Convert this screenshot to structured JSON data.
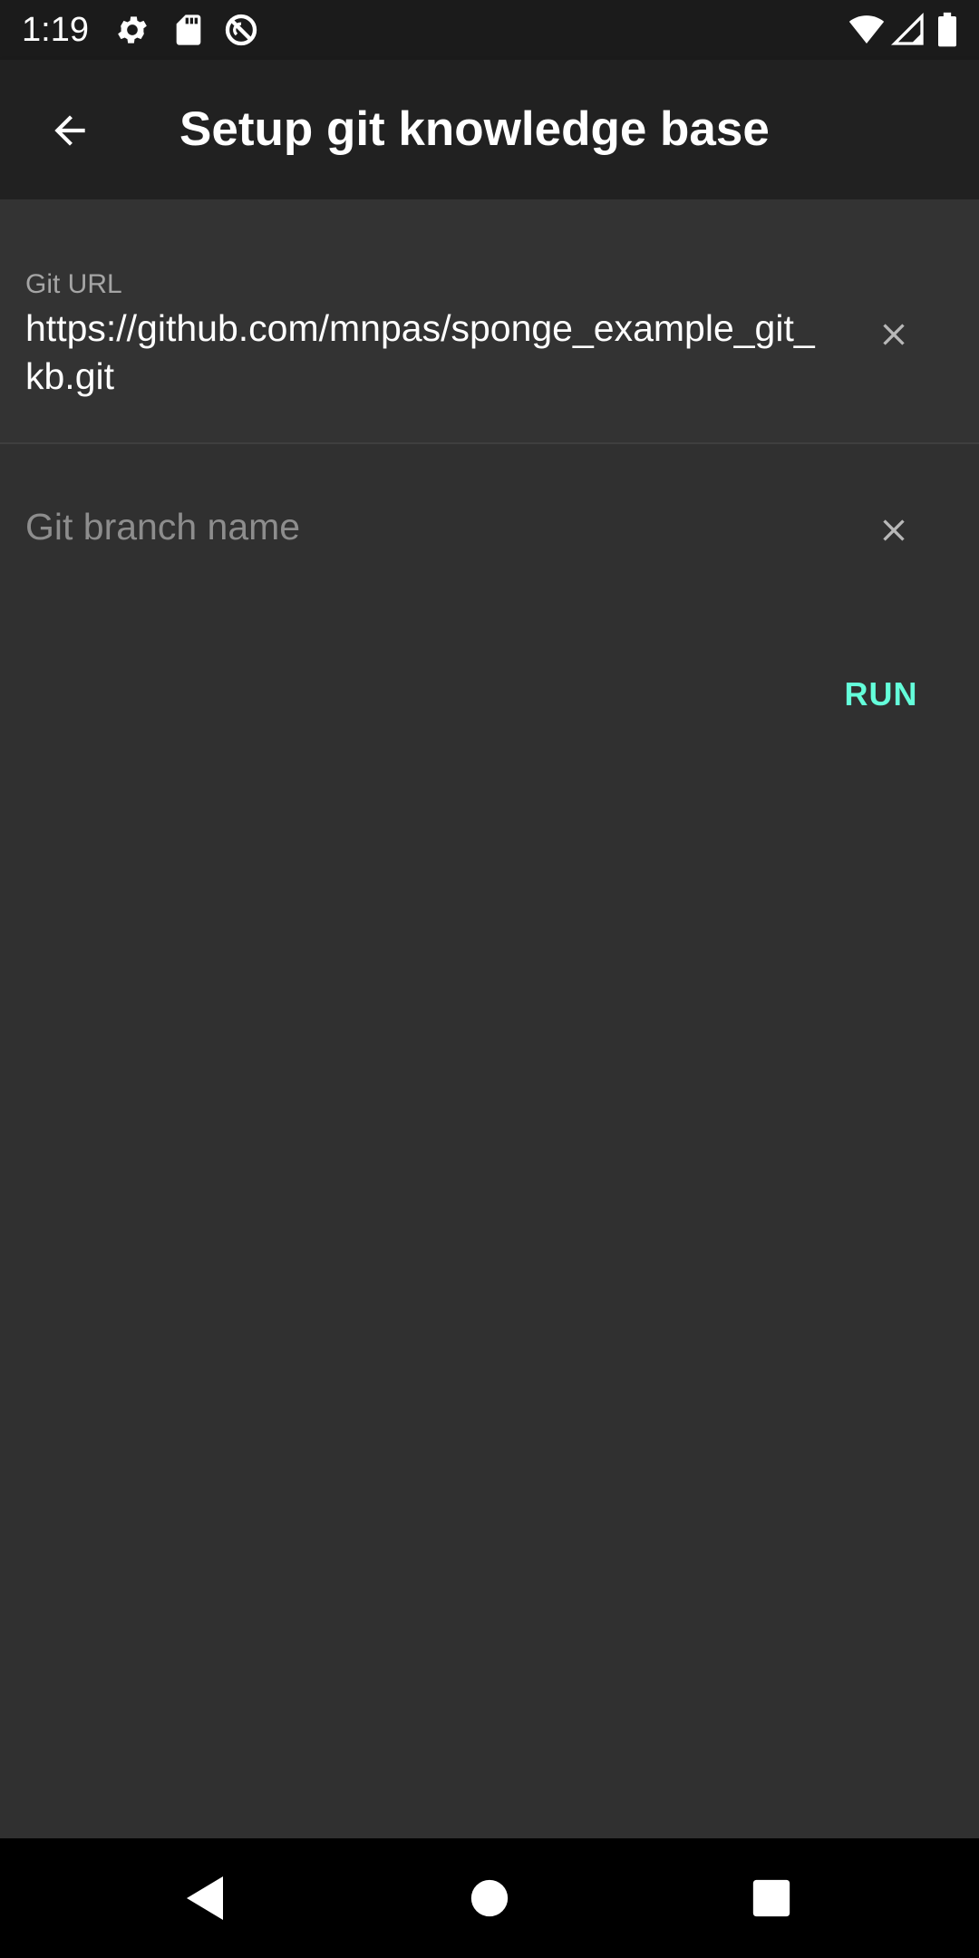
{
  "status_bar": {
    "time": "1:19",
    "icons_left": [
      "settings-icon",
      "sd-card-icon",
      "no-sync-icon"
    ],
    "icons_right": [
      "wifi-icon",
      "cell-signal-icon",
      "battery-icon"
    ]
  },
  "app_bar": {
    "title": "Setup git knowledge base",
    "back_icon": "arrow-back-icon"
  },
  "form": {
    "git_url": {
      "label": "Git URL",
      "value": "https://github.com/mnpas/sponge_example_git_kb.git",
      "clear_icon": "close-icon"
    },
    "git_branch": {
      "placeholder": "Git branch name",
      "value": "",
      "clear_icon": "close-icon"
    },
    "run_label": "RUN"
  },
  "nav_bar": {
    "icons": [
      "back-triangle-icon",
      "home-circle-icon",
      "recents-square-icon"
    ]
  },
  "colors": {
    "accent": "#64ffda",
    "background": "#303030",
    "app_bar": "#212121",
    "status_bar": "#1b1b1b"
  }
}
